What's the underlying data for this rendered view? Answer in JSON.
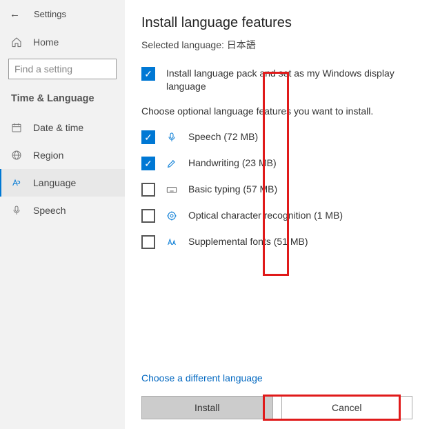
{
  "sidebar": {
    "settings_label": "Settings",
    "home_label": "Home",
    "search_placeholder": "Find a setting",
    "group_heading": "Time & Language",
    "items": [
      {
        "label": "Date & time"
      },
      {
        "label": "Region"
      },
      {
        "label": "Language"
      },
      {
        "label": "Speech"
      }
    ]
  },
  "main": {
    "title": "Install language features",
    "selected_prefix": "Selected language: ",
    "selected_language": "日本語",
    "primary_option": "Install language pack and set as my Windows display language",
    "instruction": "Choose optional language features you want to install.",
    "features": [
      {
        "label": "Speech (72 MB)",
        "checked": true,
        "icon": "microphone-icon"
      },
      {
        "label": "Handwriting (23 MB)",
        "checked": true,
        "icon": "handwriting-icon"
      },
      {
        "label": "Basic typing (57 MB)",
        "checked": false,
        "icon": "keyboard-icon"
      },
      {
        "label": "Optical character recognition (1 MB)",
        "checked": false,
        "icon": "ocr-icon"
      },
      {
        "label": "Supplemental fonts (51 MB)",
        "checked": false,
        "icon": "font-icon"
      }
    ],
    "choose_link": "Choose a different language",
    "install_btn": "Install",
    "cancel_btn": "Cancel"
  }
}
